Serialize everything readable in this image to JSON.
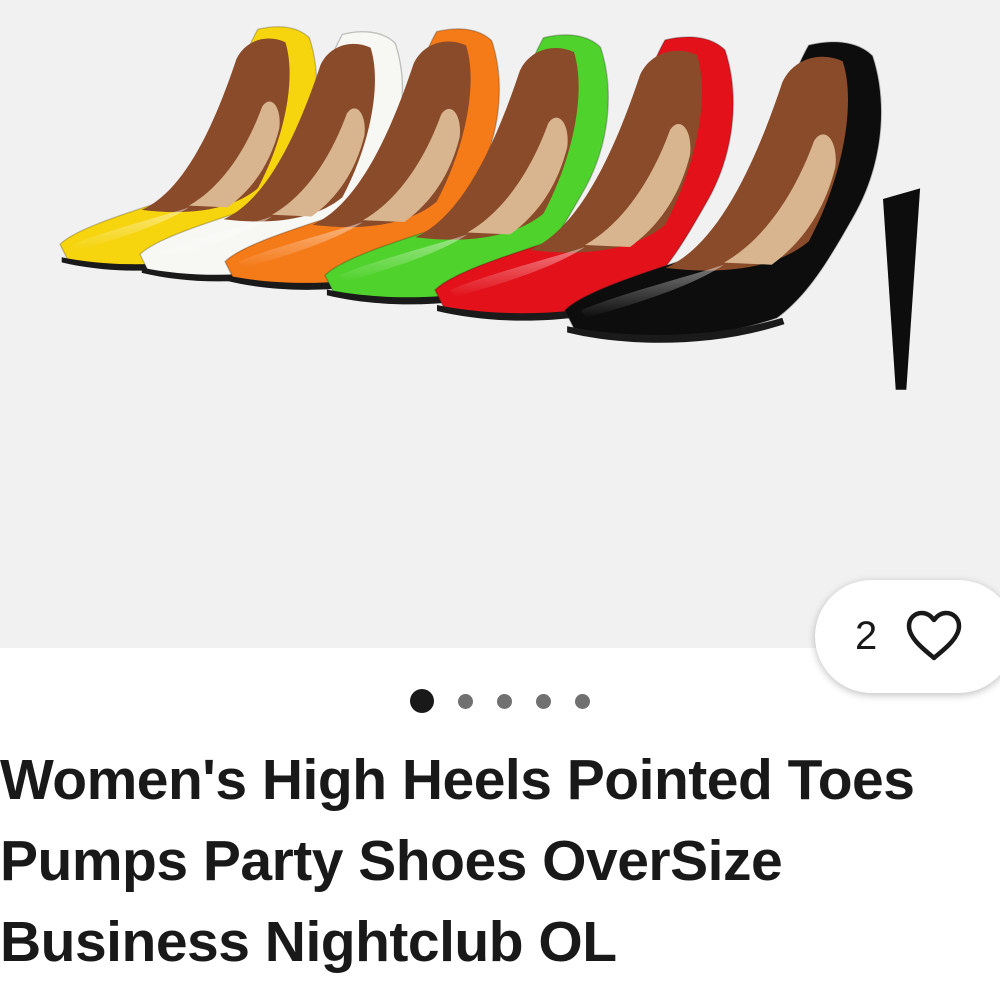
{
  "listing": {
    "image_alt": "Six pointed-toe patent high heel pumps in yellow, white, orange, green, red and black",
    "shoe_colors": [
      "#f6d40e",
      "#f7f7f4",
      "#f57a18",
      "#4fd22c",
      "#e3111a",
      "#0d0d0d"
    ],
    "favorite_count": "2",
    "favorite_icon": "heart-outline-icon",
    "carousel": {
      "total": 5,
      "active_index": 0
    },
    "title": "Women's High Heels Pointed Toes Pumps Party Shoes OverSize Business Nightclub OL"
  }
}
